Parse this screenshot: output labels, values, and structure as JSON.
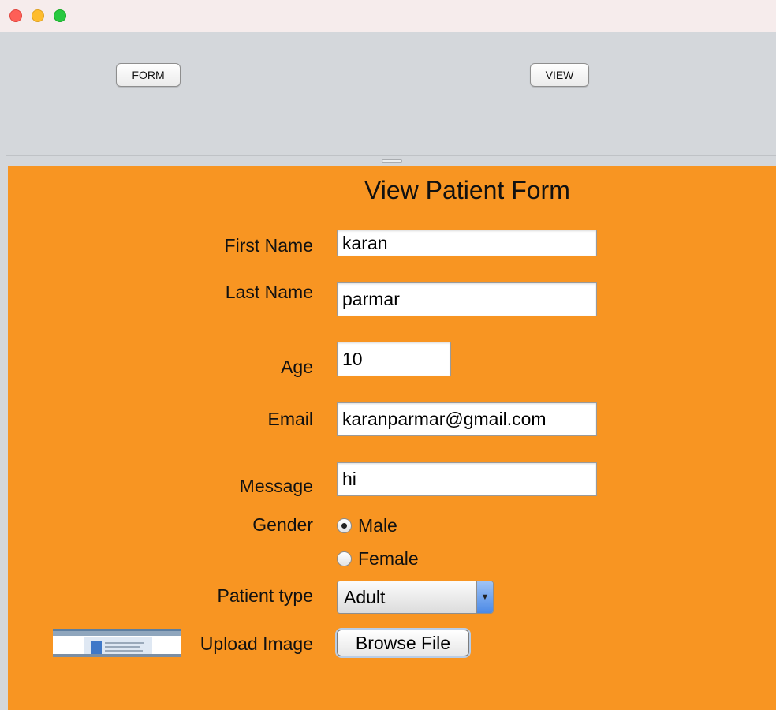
{
  "window": {
    "controls": [
      "close",
      "minimize",
      "zoom"
    ]
  },
  "toolbar": {
    "form_label": "FORM",
    "view_label": "VIEW"
  },
  "form": {
    "heading": "View Patient  Form",
    "first_name": {
      "label": "First Name",
      "value": "karan"
    },
    "last_name": {
      "label": "Last Name",
      "value": "parmar"
    },
    "age": {
      "label": "Age",
      "value": "10"
    },
    "email": {
      "label": "Email",
      "value": "karanparmar@gmail.com"
    },
    "message": {
      "label": "Message",
      "value": "hi"
    },
    "gender": {
      "label": "Gender",
      "options": [
        {
          "label": "Male",
          "checked": true
        },
        {
          "label": "Female",
          "checked": false
        }
      ]
    },
    "patient_type": {
      "label": "Patient type",
      "selected": "Adult"
    },
    "upload": {
      "label": "Upload Image",
      "button_label": "Browse File"
    }
  },
  "colors": {
    "form_background": "#f89522",
    "top_pane_background": "#d4d7db"
  }
}
